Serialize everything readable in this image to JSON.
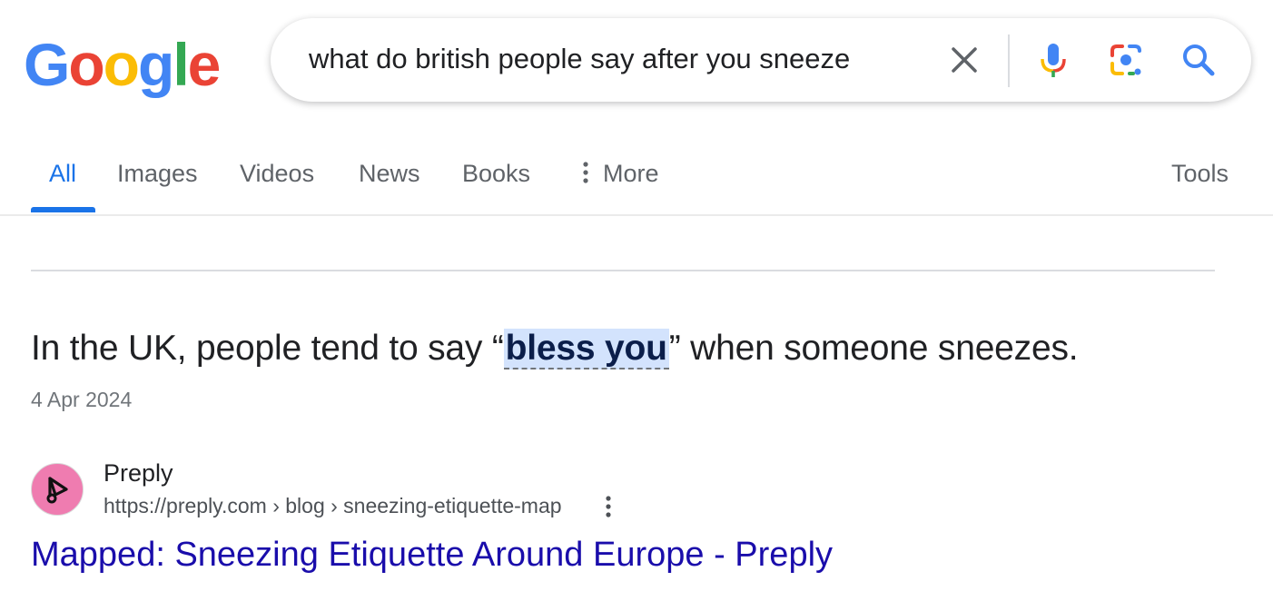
{
  "logo": {
    "letters": [
      "G",
      "o",
      "o",
      "g",
      "l",
      "e"
    ],
    "colors": [
      "#4285F4",
      "#EA4335",
      "#FBBC05",
      "#4285F4",
      "#34A853",
      "#EA4335"
    ]
  },
  "search": {
    "query": "what do british people say after you sneeze"
  },
  "icons": {
    "clear": "close-icon",
    "voice": "microphone-icon",
    "lens": "camera-lens-icon",
    "search": "search-icon"
  },
  "tabs": {
    "all": "All",
    "images": "Images",
    "videos": "Videos",
    "news": "News",
    "books": "Books",
    "more": "More",
    "tools": "Tools"
  },
  "featured": {
    "before": "In the UK, people tend to say “",
    "highlight": "bless you",
    "after": "” when someone sneezes.",
    "date": "4 Apr 2024"
  },
  "result": {
    "site": "Preply",
    "url": "https://preply.com › blog › sneezing-etiquette-map",
    "title": "Mapped: Sneezing Etiquette Around Europe - Preply"
  },
  "colors": {
    "accent": "#1a73e8",
    "link": "#1a0dab",
    "favicon_bg": "#ef7cb0"
  }
}
